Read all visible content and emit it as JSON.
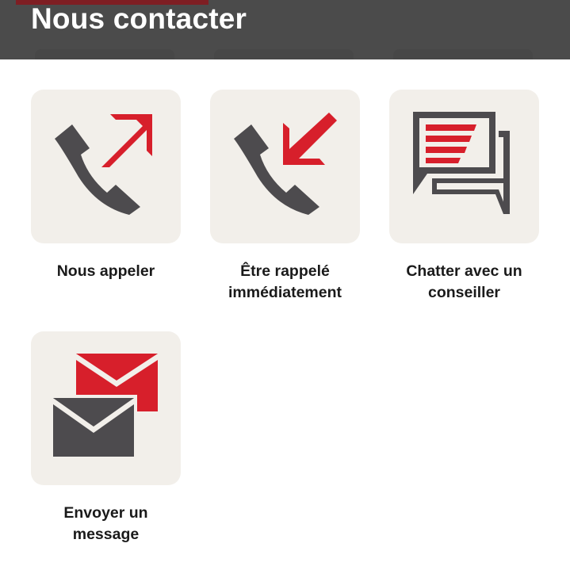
{
  "header": {
    "title": "Nous contacter"
  },
  "tiles": [
    {
      "label": "Nous appeler",
      "icon": "phone-outgoing-icon"
    },
    {
      "label": "Être rappelé\nimmédiatement",
      "icon": "phone-incoming-icon"
    },
    {
      "label": "Chatter avec un\nconseiller",
      "icon": "chat-bubbles-icon"
    },
    {
      "label": "Envoyer un\nmessage",
      "icon": "envelopes-icon"
    }
  ],
  "colors": {
    "header_bg": "#4b4b4b",
    "tile_bg": "#f2efea",
    "accent_red": "#d71f2b",
    "icon_gray": "#4d4b4e",
    "text": "#1a1a1a"
  }
}
